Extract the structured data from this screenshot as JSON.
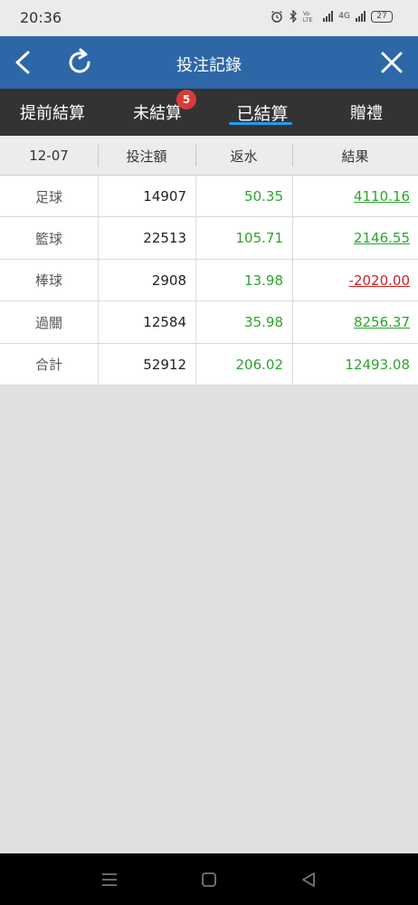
{
  "status_bar": {
    "time": "20:36",
    "network": "4G",
    "battery": "27"
  },
  "header": {
    "title": "投注記錄"
  },
  "tabs": [
    {
      "label": "提前結算",
      "active": false
    },
    {
      "label": "未結算",
      "active": false,
      "badge": "5"
    },
    {
      "label": "已結算",
      "active": true
    },
    {
      "label": "贈禮",
      "active": false
    }
  ],
  "table": {
    "columns": [
      "12-07",
      "投注額",
      "返水",
      "結果"
    ],
    "rows": [
      {
        "sport": "足球",
        "stake": "14907",
        "rebate": "50.35",
        "result": "4110.16",
        "result_status": "positive"
      },
      {
        "sport": "籃球",
        "stake": "22513",
        "rebate": "105.71",
        "result": "2146.55",
        "result_status": "positive"
      },
      {
        "sport": "棒球",
        "stake": "2908",
        "rebate": "13.98",
        "result": "-2020.00",
        "result_status": "negative"
      },
      {
        "sport": "過關",
        "stake": "12584",
        "rebate": "35.98",
        "result": "8256.37",
        "result_status": "positive"
      }
    ],
    "total": {
      "label": "合計",
      "stake": "52912",
      "rebate": "206.02",
      "result": "12493.08"
    }
  },
  "colors": {
    "header": "#2d67a8",
    "tabs_bg": "#333333",
    "tab_underline": "#1e9ff0",
    "positive": "#2aa52a",
    "negative": "#d31f1f",
    "badge": "#d93a3a"
  },
  "icons": {
    "back": "chevron-left-icon",
    "refresh": "refresh-icon",
    "close": "close-icon",
    "nav_menu": "menu-icon",
    "nav_home": "home-square-icon",
    "nav_back": "back-triangle-icon"
  }
}
